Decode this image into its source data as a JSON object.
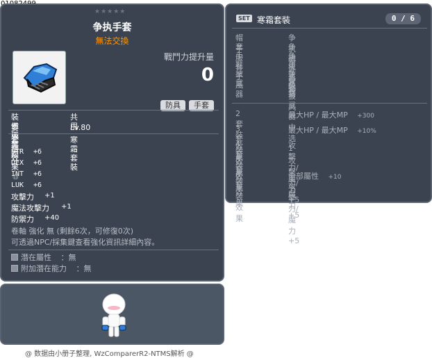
{
  "item_id": "01082499",
  "stars": "★★★★★",
  "item": {
    "name": "争执手套",
    "tradability": "無法交換",
    "damage_label": "戰鬥力提升量",
    "damage_value": "0",
    "tags": [
      "防具",
      "手套"
    ],
    "job_label": "裝備職業",
    "job_value": "共用",
    "level_label": "要求等級",
    "level_value": "Lv.80",
    "set_label": "套組效果",
    "set_value": "寒霜套裝",
    "stats": [
      {
        "name": "STR",
        "value": "+6"
      },
      {
        "name": "DEX",
        "value": "+6"
      },
      {
        "name": "INT",
        "value": "+6"
      },
      {
        "name": "LUK",
        "value": "+6"
      }
    ],
    "combat": [
      {
        "name": "攻擊力",
        "value": "+1"
      },
      {
        "name": "魔法攻擊力",
        "value": "+1"
      },
      {
        "name": "防禦力",
        "value": "+40"
      }
    ],
    "scroll_text": "卷軸 強化 無 (剩餘6次，可修復0次)",
    "info_text": "可透過NPC/採集鍵查看強化資訊詳細內容。",
    "potential_label": "潛在屬性",
    "potential_value": "：無",
    "bonus_potential_label": "附加潛在能力",
    "bonus_potential_value": "：無"
  },
  "set_panel": {
    "badge": "SET",
    "name": "寒霜套裝",
    "count": "0 / 6",
    "pieces": [
      {
        "slot": "帽子",
        "item": "争执帽"
      },
      {
        "slot": "套服",
        "item": "争执连身衣"
      },
      {
        "slot": "手套",
        "item": "争执手套"
      },
      {
        "slot": "鞋子",
        "item": "争执靴"
      },
      {
        "slot": "披風",
        "item": "争执披风"
      },
      {
        "slot": "武器",
        "item": "寒霜武器中选1"
      }
    ],
    "effects": [
      {
        "label": "2套裝效果",
        "lines": [
          {
            "text": "最大HP / 最大MP",
            "num": "+300"
          }
        ]
      },
      {
        "label": "3套裝效果",
        "lines": [
          {
            "text": "最大HP / 最大MP",
            "num": "+10%"
          }
        ]
      },
      {
        "label": "4套裝效果",
        "lines": [
          {
            "text": "攻擊力/魔力+5",
            "num": ""
          }
        ]
      },
      {
        "label": "5套裝效果",
        "lines": [
          {
            "text": "攻擊力/魔力+5",
            "num": ""
          }
        ]
      },
      {
        "label": "6套裝效果",
        "lines": [
          {
            "text": "全部屬性",
            "num": "+10"
          },
          {
            "text": "攻擊力/魔力+5",
            "num": ""
          }
        ]
      }
    ]
  },
  "footer": "@ 数据由小册子整理, WzComparerR2-NTMS解析 @"
}
